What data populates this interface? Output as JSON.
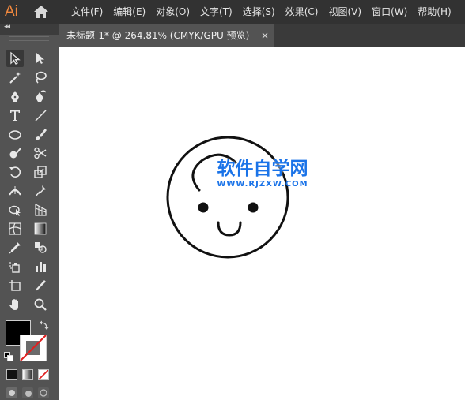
{
  "app": {
    "logo_text": "Ai"
  },
  "menu": {
    "items": [
      {
        "label": "文件(F)"
      },
      {
        "label": "编辑(E)"
      },
      {
        "label": "对象(O)"
      },
      {
        "label": "文字(T)"
      },
      {
        "label": "选择(S)"
      },
      {
        "label": "效果(C)"
      },
      {
        "label": "视图(V)"
      },
      {
        "label": "窗口(W)"
      },
      {
        "label": "帮助(H)"
      }
    ]
  },
  "document_tab": {
    "title": "未标题-1* @ 264.81% (CMYK/GPU 预览)",
    "close_glyph": "×"
  },
  "panel": {
    "collapse_glyph": "◂◂"
  },
  "tools": [
    "selection-tool",
    "direct-selection-tool",
    "magic-wand-tool",
    "lasso-tool",
    "pen-tool",
    "curvature-tool",
    "type-tool",
    "line-segment-tool",
    "ellipse-tool",
    "paintbrush-tool",
    "shaper-tool",
    "scissors-tool",
    "rotate-tool",
    "scale-tool",
    "width-tool",
    "puppet-warp-tool",
    "shape-builder-tool",
    "perspective-grid-tool",
    "mesh-tool",
    "gradient-tool",
    "eyedropper-tool",
    "blend-tool",
    "symbol-sprayer-tool",
    "column-graph-tool",
    "artboard-tool",
    "slice-tool",
    "hand-tool",
    "zoom-tool"
  ],
  "colors": {
    "menubar": "#323232",
    "panel": "#535353",
    "canvas": "#ffffff",
    "fill": "#000000",
    "stroke": "none",
    "accent_logo": "#f0883e",
    "watermark": "#1a73e8"
  },
  "watermark": {
    "title": "软件自学网",
    "url": "WWW.RJZXW.COM"
  }
}
